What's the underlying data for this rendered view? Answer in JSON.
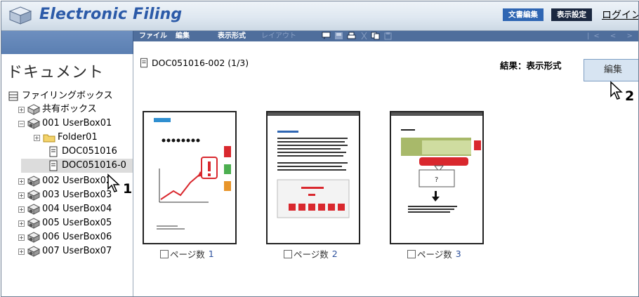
{
  "app": {
    "title": "Electronic Filing",
    "top_buttons": [
      "文書編集",
      "表示設定"
    ],
    "login_label": "ログイン"
  },
  "menu": {
    "items": [
      {
        "label": "ファイル",
        "enabled": true
      },
      {
        "label": "編集",
        "enabled": true
      },
      {
        "label": "表示形式",
        "enabled": true
      },
      {
        "label": "レイアウト",
        "enabled": false
      }
    ],
    "toolbar_icons": [
      "comment-icon",
      "save-icon",
      "print-icon",
      "cut-icon",
      "copy-icon",
      "paste-icon"
    ],
    "nav_arrows": "|< < > >|"
  },
  "sidebar": {
    "heading": "ドキュメント",
    "root": "ファイリングボックス",
    "items": [
      {
        "label": "共有ボックス",
        "expander": "+",
        "icon": "shared-box-icon"
      },
      {
        "label": "001 UserBox01",
        "expander": "−",
        "icon": "userbox-icon"
      },
      {
        "label": "Folder01",
        "expander": "+",
        "icon": "folder-icon"
      },
      {
        "label": "DOC051016",
        "expander": "",
        "icon": "document-icon"
      },
      {
        "label": "DOC051016-0",
        "expander": "",
        "icon": "document-icon"
      },
      {
        "label": "002 UserBox02",
        "expander": "+",
        "icon": "userbox-icon"
      },
      {
        "label": "003 UserBox03",
        "expander": "+",
        "icon": "userbox-icon"
      },
      {
        "label": "004 UserBox04",
        "expander": "+",
        "icon": "userbox-icon"
      },
      {
        "label": "005 UserBox05",
        "expander": "+",
        "icon": "userbox-icon"
      },
      {
        "label": "006 UserBox06",
        "expander": "+",
        "icon": "userbox-icon"
      },
      {
        "label": "007 UserBox07",
        "expander": "+",
        "icon": "userbox-icon"
      }
    ]
  },
  "main": {
    "document_title": "DOC051016-002 (1/3)",
    "result_label": "結果：表示形式",
    "edit_button": "編集",
    "pages": [
      {
        "caption": "ページ数",
        "number": "1"
      },
      {
        "caption": "ページ数",
        "number": "2"
      },
      {
        "caption": "ページ数",
        "number": "3"
      }
    ]
  },
  "callouts": {
    "step1": "1",
    "step2": "2"
  },
  "colors": {
    "title_text": "#2b5aa8",
    "menubar": "#4f6e9c",
    "btn_doc": "#2f66b3",
    "btn_disp": "#1b2840",
    "edit_button_bg": "#d7e4f2",
    "selected_row": "#dcdcdc"
  }
}
